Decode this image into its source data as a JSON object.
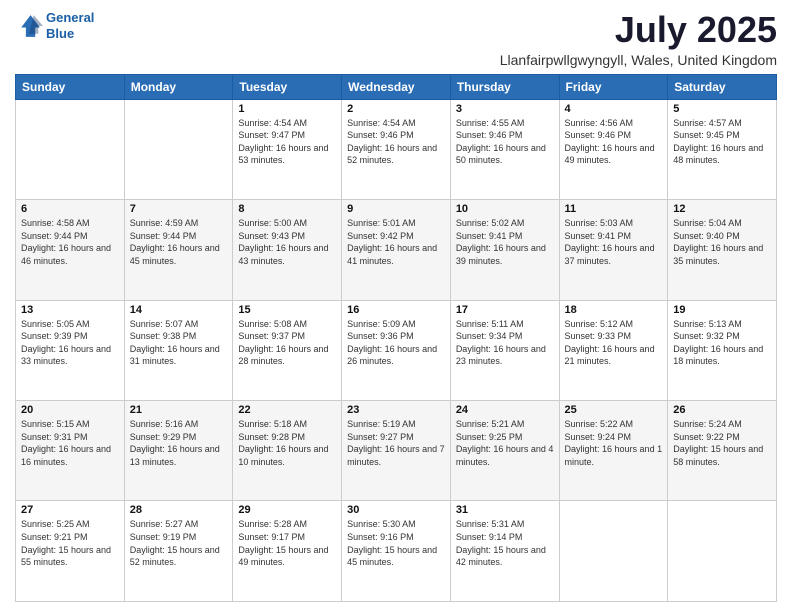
{
  "logo": {
    "line1": "General",
    "line2": "Blue"
  },
  "title": {
    "month_year": "July 2025",
    "location": "Llanfairpwllgwyngyll, Wales, United Kingdom"
  },
  "columns": [
    "Sunday",
    "Monday",
    "Tuesday",
    "Wednesday",
    "Thursday",
    "Friday",
    "Saturday"
  ],
  "weeks": [
    [
      {
        "day": "",
        "sunrise": "",
        "sunset": "",
        "daylight": ""
      },
      {
        "day": "",
        "sunrise": "",
        "sunset": "",
        "daylight": ""
      },
      {
        "day": "1",
        "sunrise": "Sunrise: 4:54 AM",
        "sunset": "Sunset: 9:47 PM",
        "daylight": "Daylight: 16 hours and 53 minutes."
      },
      {
        "day": "2",
        "sunrise": "Sunrise: 4:54 AM",
        "sunset": "Sunset: 9:46 PM",
        "daylight": "Daylight: 16 hours and 52 minutes."
      },
      {
        "day": "3",
        "sunrise": "Sunrise: 4:55 AM",
        "sunset": "Sunset: 9:46 PM",
        "daylight": "Daylight: 16 hours and 50 minutes."
      },
      {
        "day": "4",
        "sunrise": "Sunrise: 4:56 AM",
        "sunset": "Sunset: 9:46 PM",
        "daylight": "Daylight: 16 hours and 49 minutes."
      },
      {
        "day": "5",
        "sunrise": "Sunrise: 4:57 AM",
        "sunset": "Sunset: 9:45 PM",
        "daylight": "Daylight: 16 hours and 48 minutes."
      }
    ],
    [
      {
        "day": "6",
        "sunrise": "Sunrise: 4:58 AM",
        "sunset": "Sunset: 9:44 PM",
        "daylight": "Daylight: 16 hours and 46 minutes."
      },
      {
        "day": "7",
        "sunrise": "Sunrise: 4:59 AM",
        "sunset": "Sunset: 9:44 PM",
        "daylight": "Daylight: 16 hours and 45 minutes."
      },
      {
        "day": "8",
        "sunrise": "Sunrise: 5:00 AM",
        "sunset": "Sunset: 9:43 PM",
        "daylight": "Daylight: 16 hours and 43 minutes."
      },
      {
        "day": "9",
        "sunrise": "Sunrise: 5:01 AM",
        "sunset": "Sunset: 9:42 PM",
        "daylight": "Daylight: 16 hours and 41 minutes."
      },
      {
        "day": "10",
        "sunrise": "Sunrise: 5:02 AM",
        "sunset": "Sunset: 9:41 PM",
        "daylight": "Daylight: 16 hours and 39 minutes."
      },
      {
        "day": "11",
        "sunrise": "Sunrise: 5:03 AM",
        "sunset": "Sunset: 9:41 PM",
        "daylight": "Daylight: 16 hours and 37 minutes."
      },
      {
        "day": "12",
        "sunrise": "Sunrise: 5:04 AM",
        "sunset": "Sunset: 9:40 PM",
        "daylight": "Daylight: 16 hours and 35 minutes."
      }
    ],
    [
      {
        "day": "13",
        "sunrise": "Sunrise: 5:05 AM",
        "sunset": "Sunset: 9:39 PM",
        "daylight": "Daylight: 16 hours and 33 minutes."
      },
      {
        "day": "14",
        "sunrise": "Sunrise: 5:07 AM",
        "sunset": "Sunset: 9:38 PM",
        "daylight": "Daylight: 16 hours and 31 minutes."
      },
      {
        "day": "15",
        "sunrise": "Sunrise: 5:08 AM",
        "sunset": "Sunset: 9:37 PM",
        "daylight": "Daylight: 16 hours and 28 minutes."
      },
      {
        "day": "16",
        "sunrise": "Sunrise: 5:09 AM",
        "sunset": "Sunset: 9:36 PM",
        "daylight": "Daylight: 16 hours and 26 minutes."
      },
      {
        "day": "17",
        "sunrise": "Sunrise: 5:11 AM",
        "sunset": "Sunset: 9:34 PM",
        "daylight": "Daylight: 16 hours and 23 minutes."
      },
      {
        "day": "18",
        "sunrise": "Sunrise: 5:12 AM",
        "sunset": "Sunset: 9:33 PM",
        "daylight": "Daylight: 16 hours and 21 minutes."
      },
      {
        "day": "19",
        "sunrise": "Sunrise: 5:13 AM",
        "sunset": "Sunset: 9:32 PM",
        "daylight": "Daylight: 16 hours and 18 minutes."
      }
    ],
    [
      {
        "day": "20",
        "sunrise": "Sunrise: 5:15 AM",
        "sunset": "Sunset: 9:31 PM",
        "daylight": "Daylight: 16 hours and 16 minutes."
      },
      {
        "day": "21",
        "sunrise": "Sunrise: 5:16 AM",
        "sunset": "Sunset: 9:29 PM",
        "daylight": "Daylight: 16 hours and 13 minutes."
      },
      {
        "day": "22",
        "sunrise": "Sunrise: 5:18 AM",
        "sunset": "Sunset: 9:28 PM",
        "daylight": "Daylight: 16 hours and 10 minutes."
      },
      {
        "day": "23",
        "sunrise": "Sunrise: 5:19 AM",
        "sunset": "Sunset: 9:27 PM",
        "daylight": "Daylight: 16 hours and 7 minutes."
      },
      {
        "day": "24",
        "sunrise": "Sunrise: 5:21 AM",
        "sunset": "Sunset: 9:25 PM",
        "daylight": "Daylight: 16 hours and 4 minutes."
      },
      {
        "day": "25",
        "sunrise": "Sunrise: 5:22 AM",
        "sunset": "Sunset: 9:24 PM",
        "daylight": "Daylight: 16 hours and 1 minute."
      },
      {
        "day": "26",
        "sunrise": "Sunrise: 5:24 AM",
        "sunset": "Sunset: 9:22 PM",
        "daylight": "Daylight: 15 hours and 58 minutes."
      }
    ],
    [
      {
        "day": "27",
        "sunrise": "Sunrise: 5:25 AM",
        "sunset": "Sunset: 9:21 PM",
        "daylight": "Daylight: 15 hours and 55 minutes."
      },
      {
        "day": "28",
        "sunrise": "Sunrise: 5:27 AM",
        "sunset": "Sunset: 9:19 PM",
        "daylight": "Daylight: 15 hours and 52 minutes."
      },
      {
        "day": "29",
        "sunrise": "Sunrise: 5:28 AM",
        "sunset": "Sunset: 9:17 PM",
        "daylight": "Daylight: 15 hours and 49 minutes."
      },
      {
        "day": "30",
        "sunrise": "Sunrise: 5:30 AM",
        "sunset": "Sunset: 9:16 PM",
        "daylight": "Daylight: 15 hours and 45 minutes."
      },
      {
        "day": "31",
        "sunrise": "Sunrise: 5:31 AM",
        "sunset": "Sunset: 9:14 PM",
        "daylight": "Daylight: 15 hours and 42 minutes."
      },
      {
        "day": "",
        "sunrise": "",
        "sunset": "",
        "daylight": ""
      },
      {
        "day": "",
        "sunrise": "",
        "sunset": "",
        "daylight": ""
      }
    ]
  ]
}
